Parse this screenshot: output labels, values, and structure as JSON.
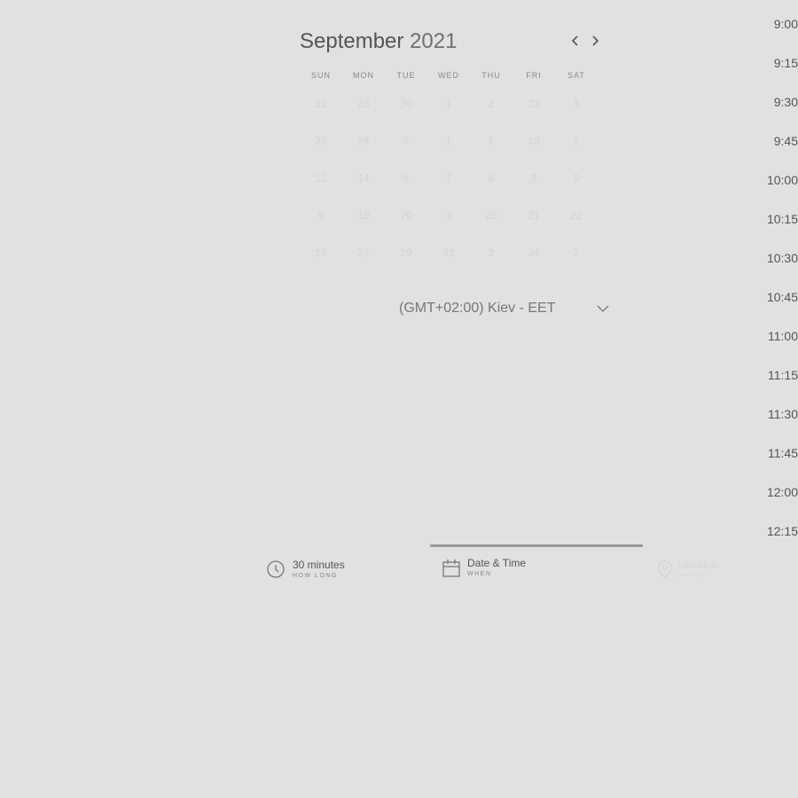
{
  "calendar": {
    "month": "September",
    "year": "2021",
    "prev_icon": "chevron-left-icon",
    "next_icon": "chevron-right-icon",
    "weekdays": [
      "SUN",
      "MON",
      "TUE",
      "WED",
      "THU",
      "FRI",
      "SAT"
    ],
    "weeks": [
      [
        "22",
        "23",
        "30",
        "1",
        "2",
        "22",
        "3"
      ],
      [
        "26",
        "24",
        "7",
        "1",
        "1",
        "10",
        "2"
      ],
      [
        "12",
        "14",
        "5",
        "7",
        "8",
        "3",
        "9"
      ],
      [
        "5",
        "10",
        "20",
        "3",
        "25",
        "21",
        "22"
      ],
      [
        "19",
        "27",
        "29",
        "31",
        "2",
        "24",
        "2"
      ]
    ]
  },
  "timezone": {
    "label": "(GMT+02:00) Kiev - EET",
    "icon": "chevron-down-icon"
  },
  "time_slots": [
    "9:00",
    "9:15",
    "9:30",
    "9:45",
    "10:00",
    "10:15",
    "10:30",
    "10:45",
    "11:00",
    "11:15",
    "11:30",
    "11:45",
    "12:00",
    "12:15"
  ],
  "steps": [
    {
      "label": "30 minutes",
      "sublabel": "HOW LONG",
      "icon": "clock-icon",
      "state": "done"
    },
    {
      "label": "Date & Time",
      "sublabel": "WHEN",
      "icon": "calendar-icon",
      "state": "active"
    },
    {
      "label": "Location",
      "sublabel": "WHERE",
      "icon": "location-icon",
      "state": "disabled"
    }
  ],
  "colors": {
    "background": "#e1e1e1",
    "text": "#555555",
    "muted_day": "#d3d3d3",
    "active_bar": "#9a9a9a"
  }
}
